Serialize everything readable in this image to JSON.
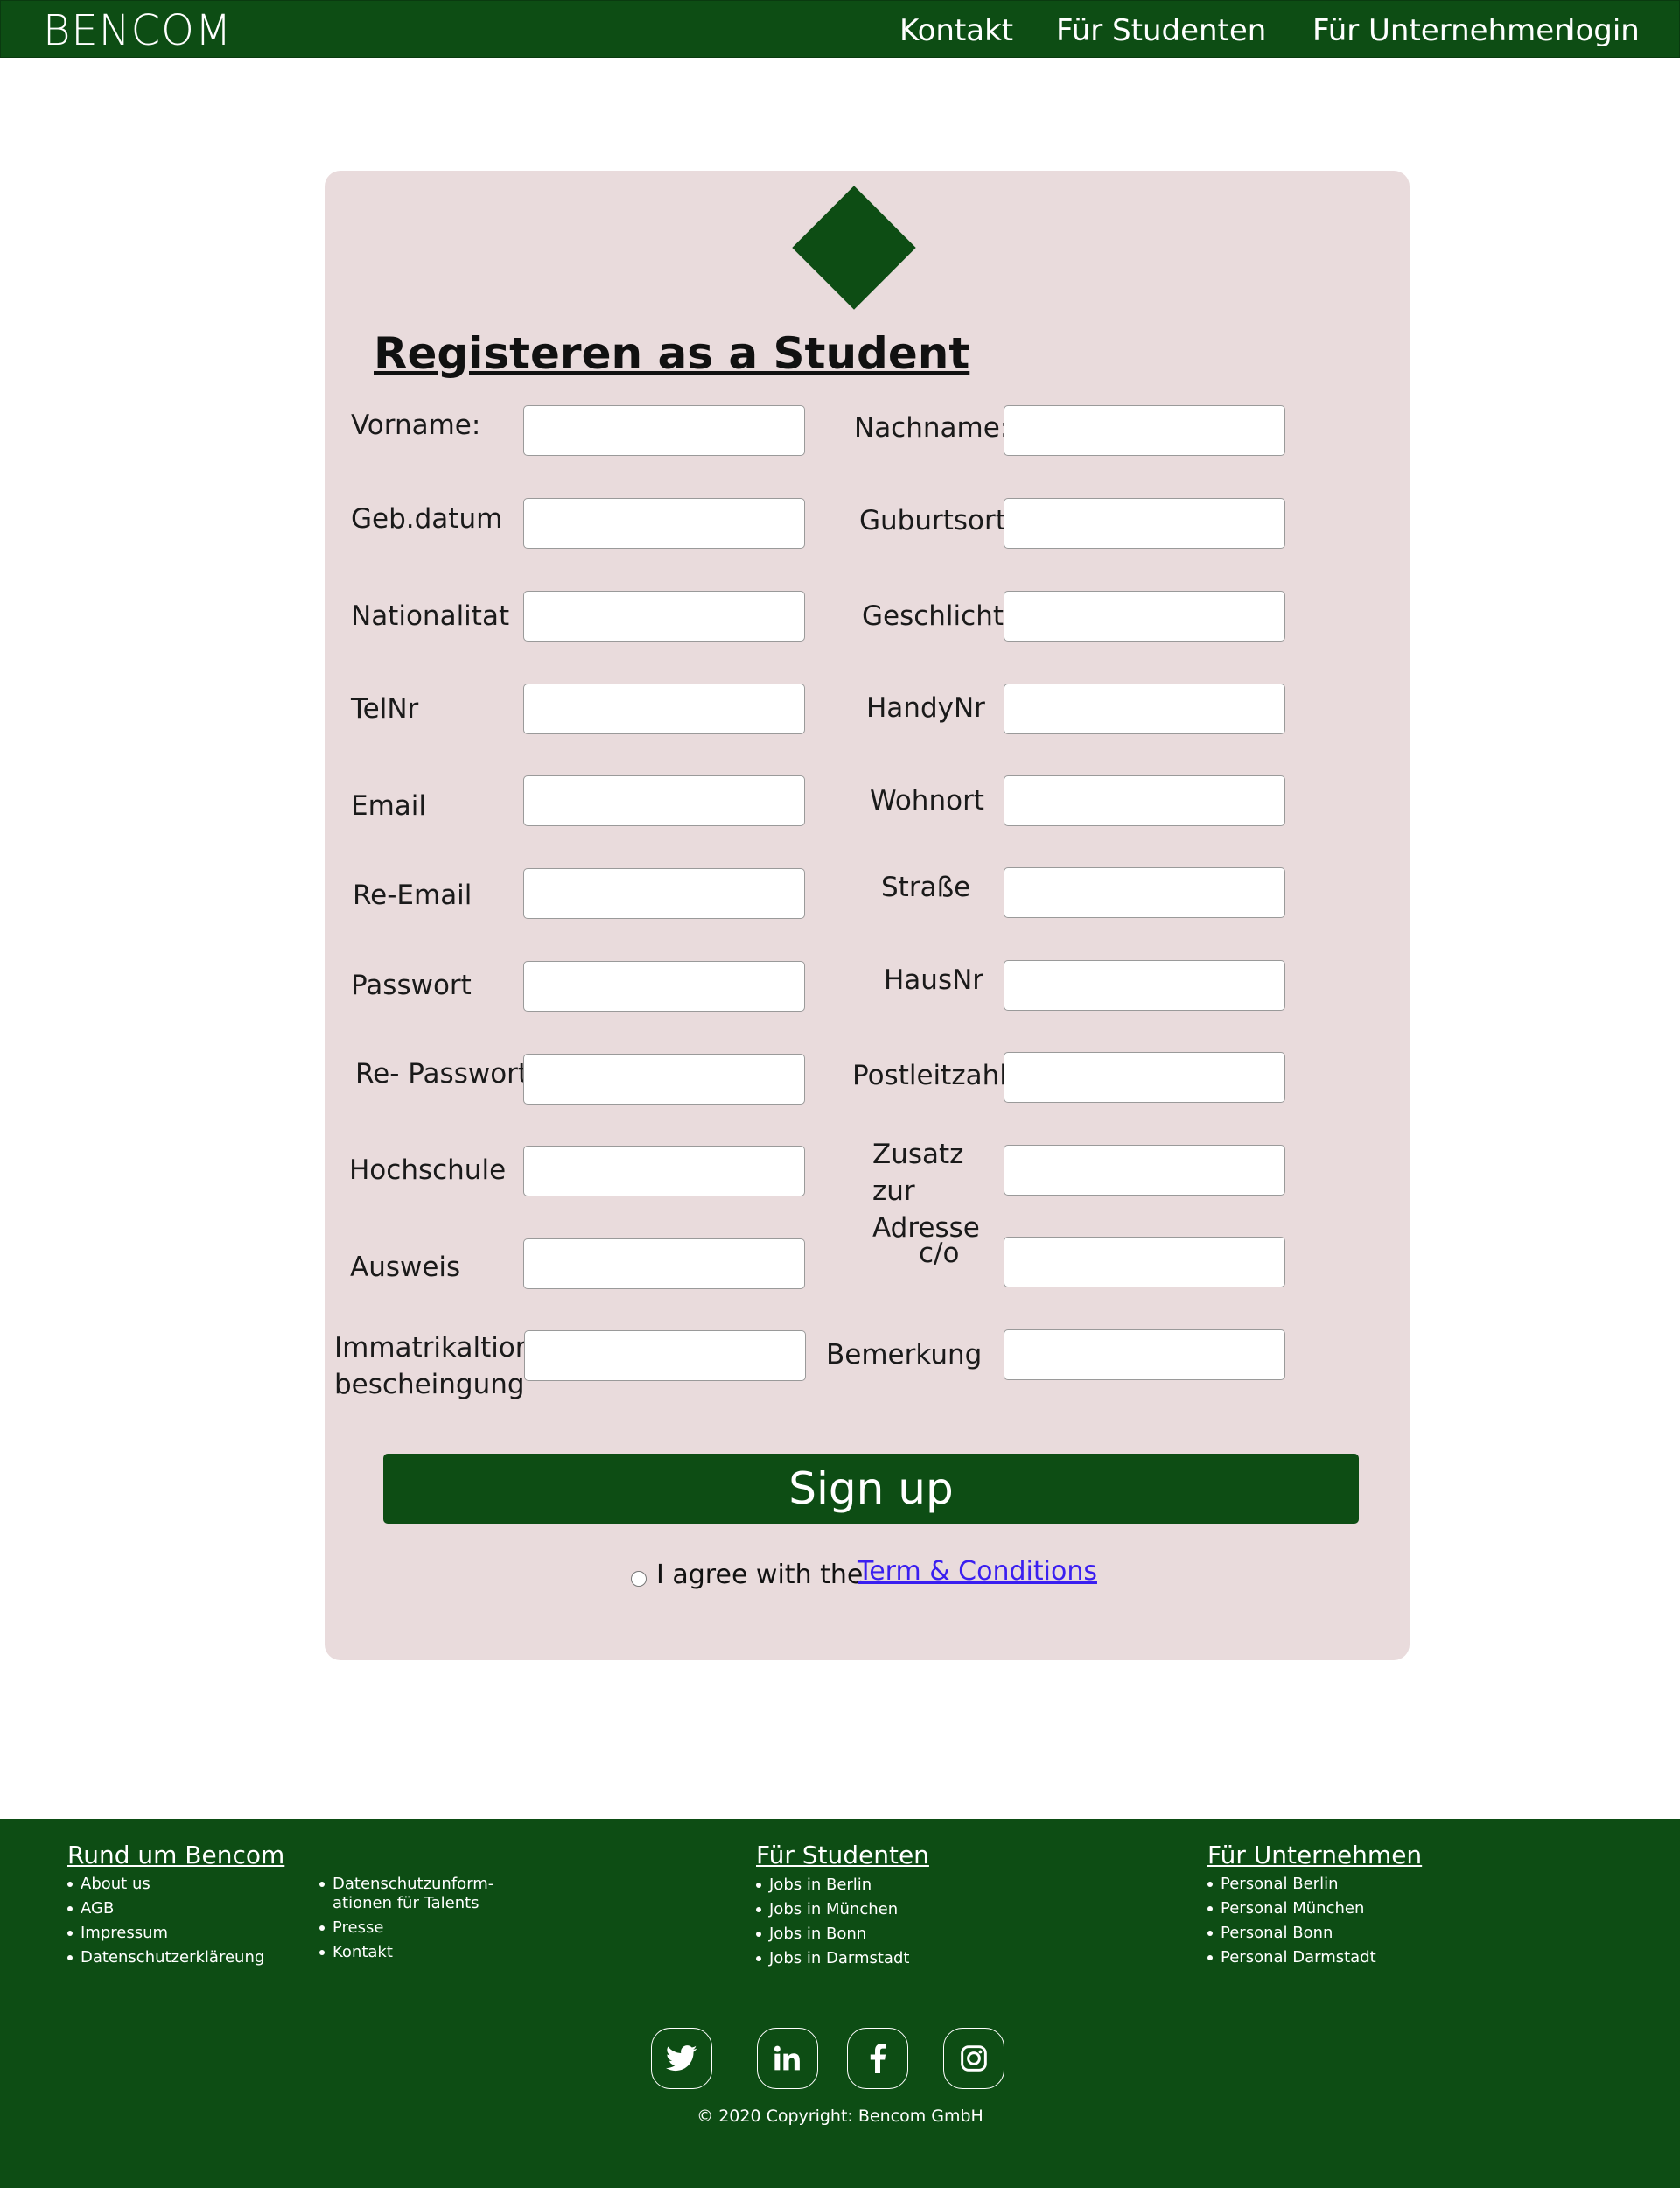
{
  "header": {
    "brand": "BENCOM",
    "nav": [
      "Kontakt",
      "Für Studenten",
      "Für Unternehmen",
      "login"
    ]
  },
  "form": {
    "title": "Registeren as a Student",
    "left_labels": [
      "Vorname:",
      "Geb.datum",
      "Nationalitat",
      "TelNr",
      "Email",
      "Re-Email",
      "Passwort",
      "Re- Passwort",
      "Hochschule",
      "Ausweis",
      "Immatrikaltions bescheingung"
    ],
    "right_labels": [
      "Nachname:",
      "Guburtsort",
      "Geschlicht",
      "HandyNr",
      "Wohnort",
      "Straße",
      "HausNr",
      "Postleitzahl",
      "Zusatz zur Adresse",
      "c/o",
      "Bemerkung"
    ],
    "submit_label": "Sign up",
    "agree_text": "I agree with the",
    "terms_link": "Term & Conditions"
  },
  "footer": {
    "col1": {
      "heading": "Rund um Bencom",
      "items_a": [
        "About us",
        "AGB",
        "Impressum",
        "Datenschutzerkläreung"
      ],
      "items_b": [
        "Datenschutzunform-ationen für Talents",
        "Presse",
        "Kontakt"
      ]
    },
    "col2": {
      "heading": "Für Studenten",
      "items": [
        "Jobs in Berlin",
        "Jobs in München",
        "Jobs in Bonn",
        "Jobs in Darmstadt"
      ]
    },
    "col3": {
      "heading": "Für Unternehmen",
      "items": [
        "Personal Berlin",
        "Personal München",
        "Personal Bonn",
        "Personal Darmstadt"
      ]
    },
    "social_icons": [
      "twitter-icon",
      "linkedin-icon",
      "facebook-icon",
      "instagram-icon"
    ],
    "copyright": "© 2020 Copyright: Bencom GmbH"
  },
  "colors": {
    "brand_green": "#0d4d14",
    "card_background": "#e9dbdc",
    "link_blue": "#3a1ff0"
  }
}
